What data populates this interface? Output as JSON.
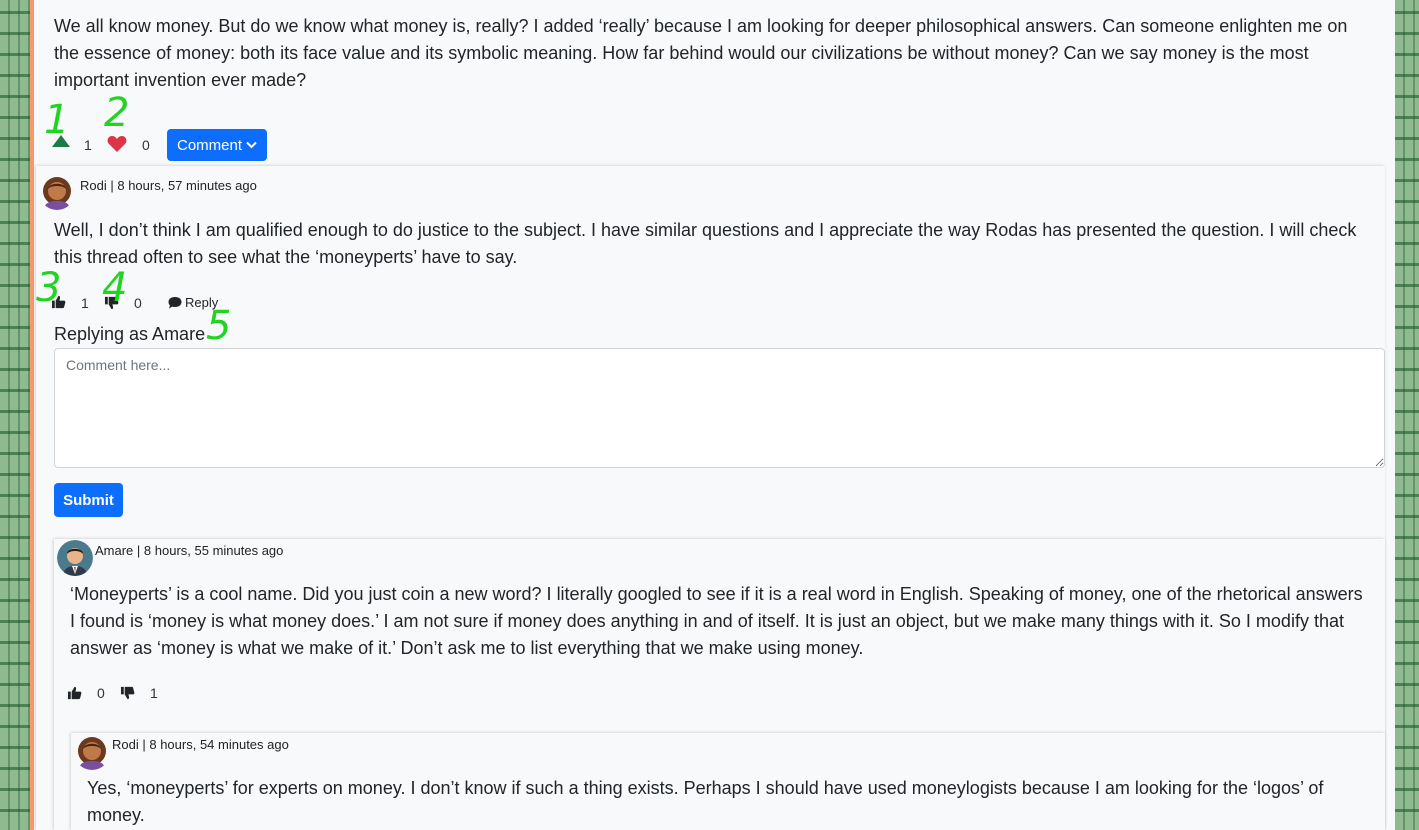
{
  "post": {
    "body": "We all know money. But do we know what money is, really? I added ‘really’ because I am looking for deeper philosophical answers. Can someone enlighten me on the essence of money: both its face value and its symbolic meaning. How far behind would our civilizations be without money? Can we say money is the most important invention ever made?",
    "upvotes": "1",
    "likes": "0",
    "comment_label": "Comment"
  },
  "comments": [
    {
      "author": "Rodi",
      "time": "8 hours, 57 minutes ago",
      "body": "Well, I don’t think I am qualified enough to do justice to the subject. I have similar questions and I appreciate the way Rodas has presented the question. I will check this thread often to see what the ‘moneyperts’ have to say.",
      "likes": "1",
      "dislikes": "0",
      "reply_label": "Reply"
    },
    {
      "author": "Amare",
      "time": "8 hours, 55 minutes ago",
      "body": "‘Moneyperts’ is a cool name. Did you just coin a new word? I literally googled to see if it is a real word in English. Speaking of money, one of the rhetorical answers I found is ‘money is what money does.’ I am not sure if money does anything in and of itself. It is just an object, but we make many things with it. So I modify that answer as ‘money is what we make of it.’ Don’t ask me to list everything that we make using money.",
      "likes": "0",
      "dislikes": "1"
    },
    {
      "author": "Rodi",
      "time": "8 hours, 54 minutes ago",
      "body": "Yes, ‘moneyperts’ for experts on money. I don’t know if such a thing exists. Perhaps I should have used moneylogists because I am looking for the ‘logos’ of money."
    }
  ],
  "reply_form": {
    "replying_as": "Replying as Amare",
    "placeholder": "Comment here...",
    "submit_label": "Submit"
  },
  "annotations": [
    "1",
    "2",
    "3",
    "4",
    "5"
  ],
  "colors": {
    "primary": "#0d6efd",
    "upvote_green": "#1f7a4a",
    "heart_red": "#dc3545",
    "annotation_green": "#22d322",
    "accent_border": "#f59a6c"
  }
}
